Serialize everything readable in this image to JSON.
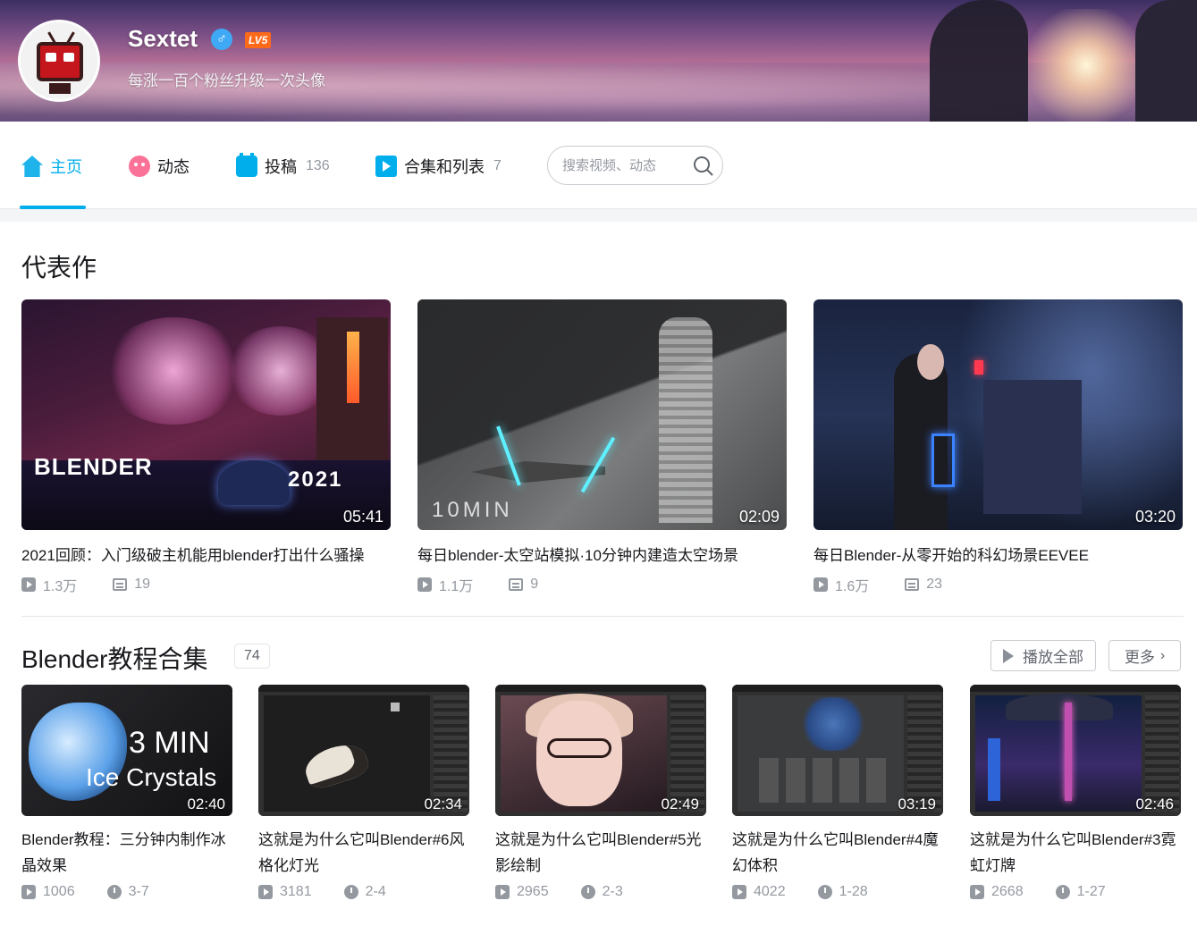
{
  "profile": {
    "username": "Sextet",
    "gender_symbol": "♂",
    "level": "LV5",
    "signature": "每涨一百个粉丝升级一次头像"
  },
  "nav": {
    "tabs": [
      {
        "label": "主页",
        "count": ""
      },
      {
        "label": "动态",
        "count": ""
      },
      {
        "label": "投稿",
        "count": "136"
      },
      {
        "label": "合集和列表",
        "count": "7"
      }
    ],
    "search_placeholder": "搜索视频、动态"
  },
  "featured": {
    "title": "代表作",
    "videos": [
      {
        "duration": "05:41",
        "title": "2021回顾：入门级破主机能用blender打出什么骚操",
        "views": "1.3万",
        "danmaku": "19",
        "thumb_text_1": "BLENDER",
        "thumb_text_2": "2021"
      },
      {
        "duration": "02:09",
        "title": "每日blender-太空站模拟·10分钟内建造太空场景",
        "views": "1.1万",
        "danmaku": "9",
        "thumb_text_1": "10MIN"
      },
      {
        "duration": "03:20",
        "title": "每日Blender-从零开始的科幻场景EEVEE",
        "views": "1.6万",
        "danmaku": "23"
      }
    ]
  },
  "collection": {
    "title": "Blender教程合集",
    "count": "74",
    "play_all_label": "播放全部",
    "more_label": "更多",
    "videos": [
      {
        "duration": "02:40",
        "title": "Blender教程：三分钟内制作冰晶效果",
        "views": "1006",
        "date": "3-7",
        "thumb_text_1": "3 MIN",
        "thumb_text_2": "Ice Crystals"
      },
      {
        "duration": "02:34",
        "title": "这就是为什么它叫Blender#6风格化灯光",
        "views": "3181",
        "date": "2-4"
      },
      {
        "duration": "02:49",
        "title": "这就是为什么它叫Blender#5光影绘制",
        "views": "2965",
        "date": "2-3"
      },
      {
        "duration": "03:19",
        "title": "这就是为什么它叫Blender#4魔幻体积",
        "views": "4022",
        "date": "1-28"
      },
      {
        "duration": "02:46",
        "title": "这就是为什么它叫Blender#3霓虹灯牌",
        "views": "2668",
        "date": "1-27"
      }
    ]
  },
  "colors": {
    "accent": "#00aeec",
    "pink": "#fb7299",
    "level_badge": "#ff6a1a",
    "text_secondary": "#9499a0"
  }
}
